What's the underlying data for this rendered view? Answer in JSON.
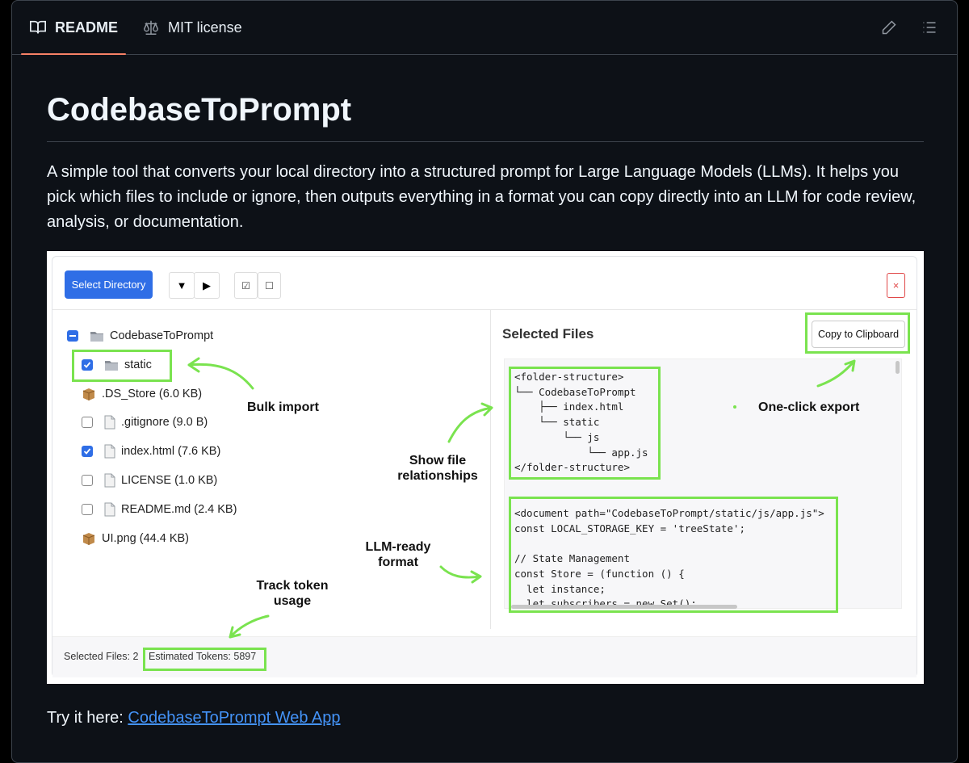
{
  "tabs": {
    "readme": "README",
    "license": "MIT license"
  },
  "readme": {
    "title": "CodebaseToPrompt",
    "description": "A simple tool that converts your local directory into a structured prompt for Large Language Models (LLMs). It helps you pick which files to include or ignore, then outputs everything in a format you can copy directly into an LLM for code review, analysis, or documentation.",
    "try_prefix": "Try it here: ",
    "try_link": "CodebaseToPrompt Web App"
  },
  "screenshot": {
    "select_directory": "Select Directory",
    "expand_btn": "▼",
    "collapse_btn": "▶",
    "check_all_btn": "☑",
    "uncheck_all_btn": "☐",
    "close_btn": "×",
    "tree": [
      {
        "label": "CodebaseToPrompt",
        "icon": "folder-icon",
        "check": "partial"
      },
      {
        "label": "static",
        "icon": "folder-icon",
        "check": "checked"
      },
      {
        "label": ".DS_Store (6.0 KB)",
        "icon": "package-icon",
        "check": "none"
      },
      {
        "label": ".gitignore (9.0 B)",
        "icon": "file-icon",
        "check": "unchecked"
      },
      {
        "label": "index.html (7.6 KB)",
        "icon": "file-icon",
        "check": "checked"
      },
      {
        "label": "LICENSE (1.0 KB)",
        "icon": "file-icon",
        "check": "unchecked"
      },
      {
        "label": "README.md (2.4 KB)",
        "icon": "file-icon",
        "check": "unchecked"
      },
      {
        "label": "UI.png (44.4 KB)",
        "icon": "package-icon",
        "check": "none"
      }
    ],
    "selected_files_heading": "Selected Files",
    "copy_button": "Copy to Clipboard",
    "folder_structure": [
      "<folder-structure>",
      "└── CodebaseToPrompt",
      "    ├── index.html",
      "    └── static",
      "        └── js",
      "            └── app.js",
      "</folder-structure>"
    ],
    "document_lines": [
      "<document path=\"CodebaseToPrompt/static/js/app.js\">",
      "const LOCAL_STORAGE_KEY = 'treeState';",
      "",
      "// State Management",
      "const Store = (function () {",
      "  let instance;",
      "  let subscribers = new Set();"
    ],
    "status_selected": "Selected Files: 2",
    "status_tokens": "Estimated Tokens: 5897",
    "annotations": {
      "bulk_import": "Bulk import",
      "show_file_1": "Show file",
      "show_file_2": "relationships",
      "llm_ready_1": "LLM-ready",
      "llm_ready_2": "format",
      "track_token_1": "Track token",
      "track_token_2": "usage",
      "one_click": "One-click export"
    },
    "accent_color": "#2f6ee6",
    "highlight_color": "#7ae34f"
  }
}
